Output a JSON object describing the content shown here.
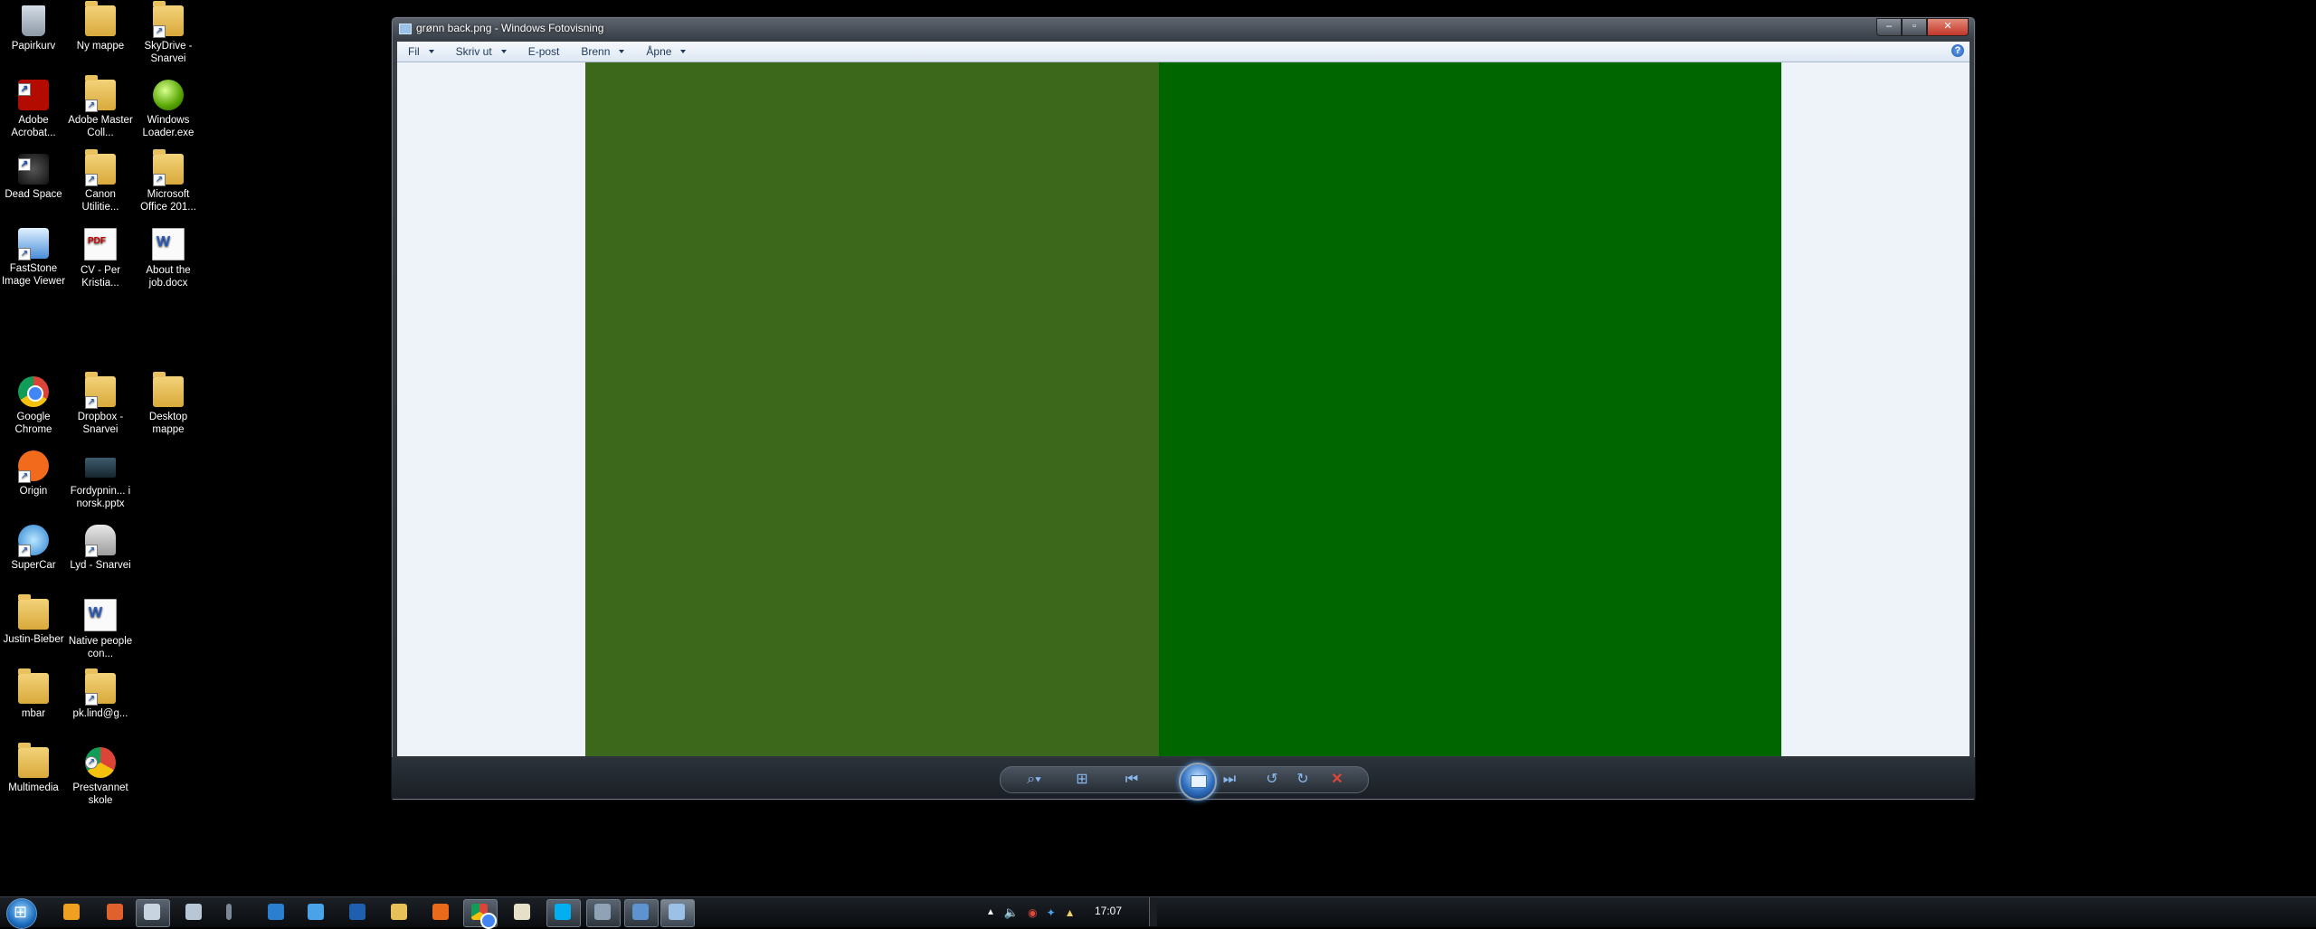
{
  "desktop": {
    "icons": [
      {
        "label": "Papirkurv"
      },
      {
        "label": "Ny mappe"
      },
      {
        "label": "SkyDrive - Snarvei"
      },
      {
        "label": "Adobe Acrobat..."
      },
      {
        "label": "Adobe Master Coll..."
      },
      {
        "label": "Windows Loader.exe"
      },
      {
        "label": "Dead Space"
      },
      {
        "label": "Canon Utilitie..."
      },
      {
        "label": "Microsoft Office 201..."
      },
      {
        "label": "FastStone Image Viewer"
      },
      {
        "label": "CV - Per Kristia..."
      },
      {
        "label": "About the job.docx"
      },
      {
        "label": "Google Chrome"
      },
      {
        "label": "Dropbox - Snarvei"
      },
      {
        "label": "Desktop mappe"
      },
      {
        "label": "Origin"
      },
      {
        "label": "Fordypnin... i norsk.pptx"
      },
      {
        "label": "SuperCar"
      },
      {
        "label": "Lyd - Snarvei"
      },
      {
        "label": "Justin-Bieber"
      },
      {
        "label": "Native people con..."
      },
      {
        "label": "mbar"
      },
      {
        "label": "pk.lind@g..."
      },
      {
        "label": "Multimedia"
      },
      {
        "label": "Prestvannet skole"
      }
    ]
  },
  "window": {
    "title": "grønn back.png - Windows Fotovisning",
    "menu": [
      {
        "label": "Fil"
      },
      {
        "label": "Skriv ut"
      },
      {
        "label": "E-post"
      },
      {
        "label": "Brenn"
      },
      {
        "label": "Åpne"
      }
    ],
    "help_label": "?",
    "controls": {
      "minimize": "–",
      "maximize": "▫",
      "close": "✕"
    },
    "photo_colors": {
      "left": "#3c681b",
      "right": "#006600",
      "background": "#eef3fa"
    }
  },
  "taskbar": {
    "clock": "17:07"
  }
}
